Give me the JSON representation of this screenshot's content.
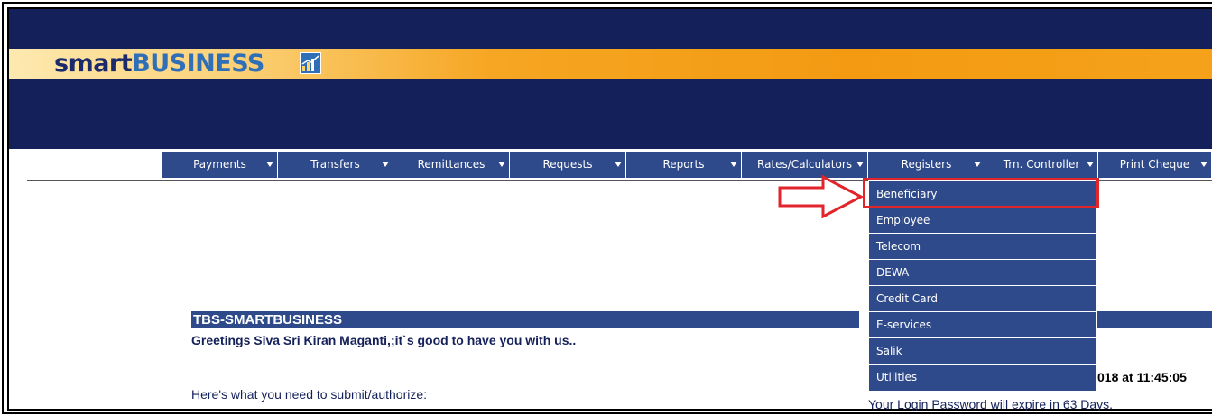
{
  "logo": {
    "part1": "smart",
    "part2": "BUSINESS"
  },
  "nav": {
    "items": [
      {
        "label": "Payments"
      },
      {
        "label": "Transfers"
      },
      {
        "label": "Remittances"
      },
      {
        "label": "Requests"
      },
      {
        "label": "Reports"
      },
      {
        "label": "Rates/Calculators"
      },
      {
        "label": "Registers"
      },
      {
        "label": "Trn. Controller"
      },
      {
        "label": "Print Cheque"
      }
    ]
  },
  "registers_menu": {
    "items": [
      {
        "label": "Beneficiary"
      },
      {
        "label": "Employee"
      },
      {
        "label": "Telecom"
      },
      {
        "label": "DEWA"
      },
      {
        "label": "Credit Card"
      },
      {
        "label": "E-services"
      },
      {
        "label": "Salik"
      },
      {
        "label": "Utilities"
      }
    ],
    "highlighted": "Beneficiary"
  },
  "main": {
    "section_title": "TBS-SMARTBUSINESS",
    "greeting": "Greetings Siva Sri Kiran Maganti,;it`s good to have you with us..",
    "submit_prompt": "Here's what you need to submit/authorize:",
    "last_login_fragment": "018 at 11:45:05",
    "password_expiry": "Your Login Password will expire in 63 Days."
  },
  "colors": {
    "header_navy": "#14205a",
    "menu_blue": "#2f4a8a",
    "accent_orange": "#f39a12",
    "highlight_red": "#e2252b"
  }
}
